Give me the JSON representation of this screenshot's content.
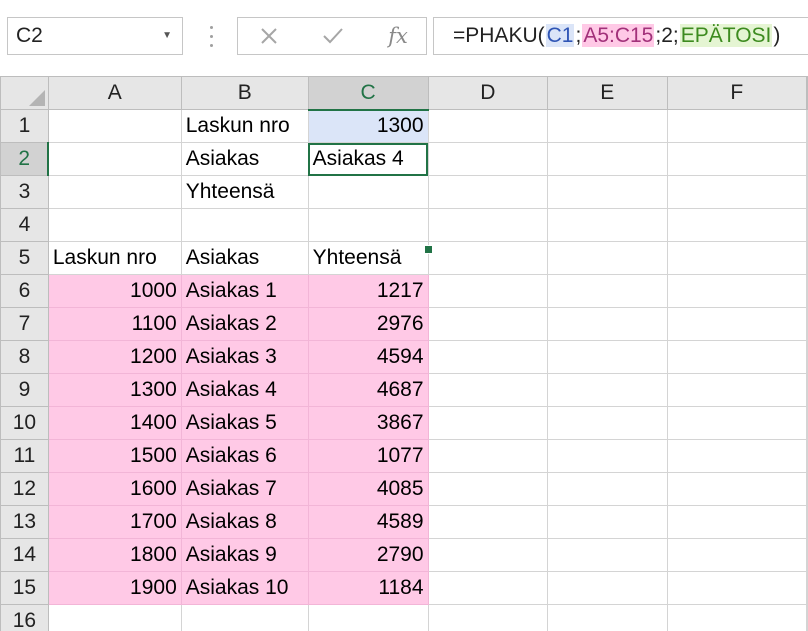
{
  "name_box": {
    "value": "C2"
  },
  "formula_bar": {
    "fx_label": "fx",
    "tokens": [
      {
        "text": "=PHAKU(",
        "color": "#222222",
        "bg": ""
      },
      {
        "text": "C1",
        "color": "#2f55b5",
        "bg": "#dbe5f8"
      },
      {
        "text": ";",
        "color": "#222222",
        "bg": ""
      },
      {
        "text": "A5:C15",
        "color": "#a2317a",
        "bg": "#ffc9e6"
      },
      {
        "text": ";2;",
        "color": "#222222",
        "bg": ""
      },
      {
        "text": "EPÄTOSI",
        "color": "#3d8b1f",
        "bg": "#e5f5d3"
      },
      {
        "text": ")",
        "color": "#222222",
        "bg": ""
      }
    ]
  },
  "grid": {
    "columns": [
      "A",
      "B",
      "C",
      "D",
      "E",
      "F"
    ],
    "selected_column": "C",
    "selected_row": 2,
    "active_cell": "C2",
    "colors": {
      "range_fill": "#ffc9e6",
      "lookup_fill": "#dbe5f8",
      "selection": "#217346"
    },
    "rows": [
      {
        "n": "1",
        "cells": [
          "",
          "Laskun nro",
          "1300",
          "",
          "",
          ""
        ]
      },
      {
        "n": "2",
        "cells": [
          "",
          "Asiakas",
          "Asiakas 4",
          "",
          "",
          ""
        ]
      },
      {
        "n": "3",
        "cells": [
          "",
          "Yhteensä",
          "",
          "",
          "",
          ""
        ]
      },
      {
        "n": "4",
        "cells": [
          "",
          "",
          "",
          "",
          "",
          ""
        ]
      },
      {
        "n": "5",
        "cells": [
          "Laskun nro",
          "Asiakas",
          "Yhteensä",
          "",
          "",
          ""
        ]
      },
      {
        "n": "6",
        "cells": [
          "1000",
          "Asiakas 1",
          "1217",
          "",
          "",
          ""
        ]
      },
      {
        "n": "7",
        "cells": [
          "1100",
          "Asiakas 2",
          "2976",
          "",
          "",
          ""
        ]
      },
      {
        "n": "8",
        "cells": [
          "1200",
          "Asiakas 3",
          "4594",
          "",
          "",
          ""
        ]
      },
      {
        "n": "9",
        "cells": [
          "1300",
          "Asiakas 4",
          "4687",
          "",
          "",
          ""
        ]
      },
      {
        "n": "10",
        "cells": [
          "1400",
          "Asiakas 5",
          "3867",
          "",
          "",
          ""
        ]
      },
      {
        "n": "11",
        "cells": [
          "1500",
          "Asiakas 6",
          "1077",
          "",
          "",
          ""
        ]
      },
      {
        "n": "12",
        "cells": [
          "1600",
          "Asiakas 7",
          "4085",
          "",
          "",
          ""
        ]
      },
      {
        "n": "13",
        "cells": [
          "1700",
          "Asiakas 8",
          "4589",
          "",
          "",
          ""
        ]
      },
      {
        "n": "14",
        "cells": [
          "1800",
          "Asiakas 9",
          "2790",
          "",
          "",
          ""
        ]
      },
      {
        "n": "15",
        "cells": [
          "1900",
          "Asiakas 10",
          "1184",
          "",
          "",
          ""
        ]
      },
      {
        "n": "16",
        "cells": [
          "",
          "",
          "",
          "",
          "",
          ""
        ]
      }
    ]
  },
  "icons": {
    "namebox_dropdown": "chevron-down-icon",
    "cancel": "close-icon",
    "enter": "checkmark-icon",
    "insert_function": "fx-icon",
    "select_all": "select-all-icon"
  }
}
